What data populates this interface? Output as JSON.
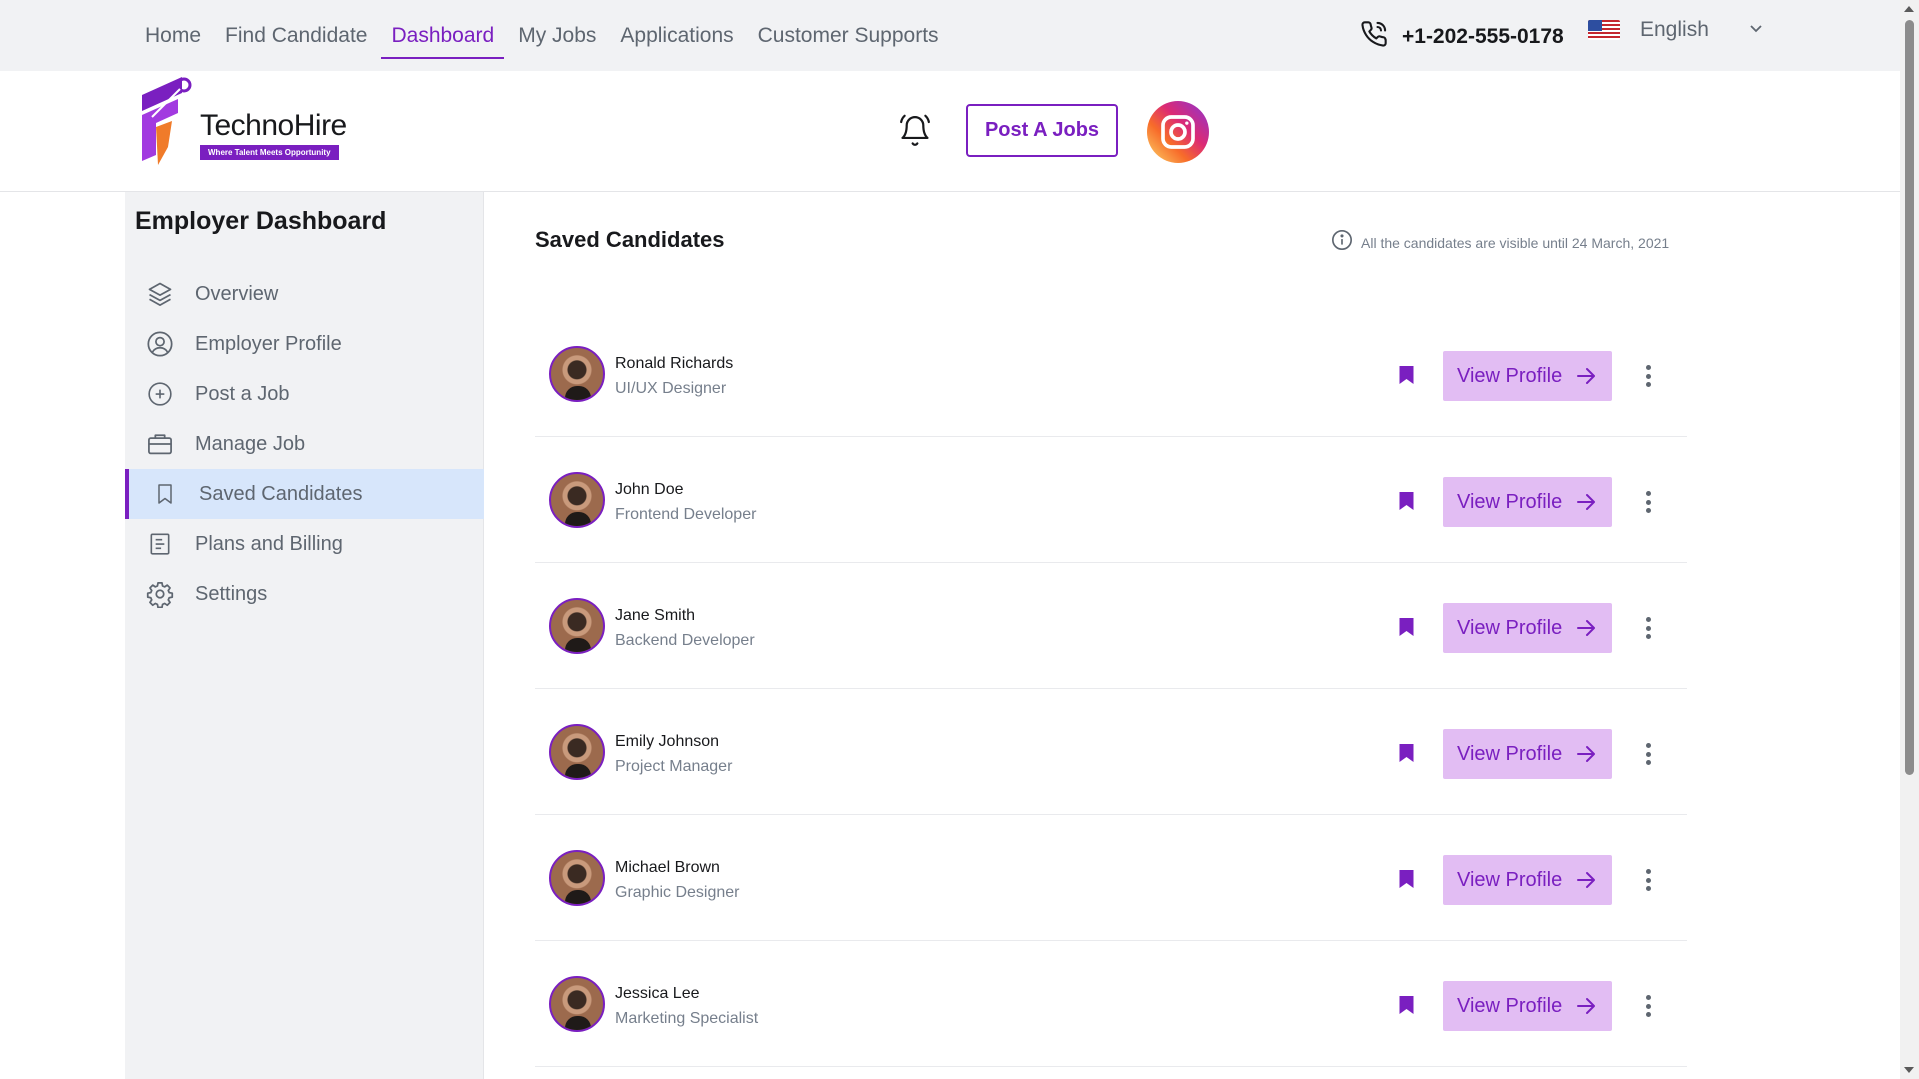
{
  "topnav": {
    "items": [
      {
        "label": "Home",
        "active": false
      },
      {
        "label": "Find Candidate",
        "active": false
      },
      {
        "label": "Dashboard",
        "active": true
      },
      {
        "label": "My Jobs",
        "active": false
      },
      {
        "label": "Applications",
        "active": false
      },
      {
        "label": "Customer Supports",
        "active": false
      }
    ],
    "phone": "+1-202-555-0178",
    "language": "English"
  },
  "header": {
    "logo_name": "TechnoHire",
    "logo_tagline": "Where Talent Meets Opportunity",
    "post_button": "Post A Jobs"
  },
  "sidebar": {
    "title": "Employer Dashboard",
    "items": [
      {
        "label": "Overview",
        "icon": "layers-icon",
        "active": false
      },
      {
        "label": "Employer Profile",
        "icon": "user-circle-icon",
        "active": false
      },
      {
        "label": "Post a Job",
        "icon": "plus-circle-icon",
        "active": false
      },
      {
        "label": "Manage Job",
        "icon": "briefcase-icon",
        "active": false
      },
      {
        "label": "Saved Candidates",
        "icon": "bookmark-icon",
        "active": true
      },
      {
        "label": "Plans and Billing",
        "icon": "document-icon",
        "active": false
      },
      {
        "label": "Settings",
        "icon": "gear-icon",
        "active": false
      }
    ]
  },
  "main": {
    "title": "Saved Candidates",
    "notice": "All the candidates are visible until 24 March, 2021",
    "view_profile_label": "View Profile",
    "candidates": [
      {
        "name": "Ronald Richards",
        "role": "UI/UX Designer"
      },
      {
        "name": "John Doe",
        "role": "Frontend Developer"
      },
      {
        "name": "Jane Smith",
        "role": "Backend Developer"
      },
      {
        "name": "Emily Johnson",
        "role": "Project Manager"
      },
      {
        "name": "Michael Brown",
        "role": "Graphic Designer"
      },
      {
        "name": "Jessica Lee",
        "role": "Marketing Specialist"
      }
    ]
  },
  "colors": {
    "accent": "#7a1fc0",
    "button_bg": "#e2bdf3",
    "active_menu_bg": "#d7e6fb",
    "sidebar_bg": "#f1f2f4"
  }
}
